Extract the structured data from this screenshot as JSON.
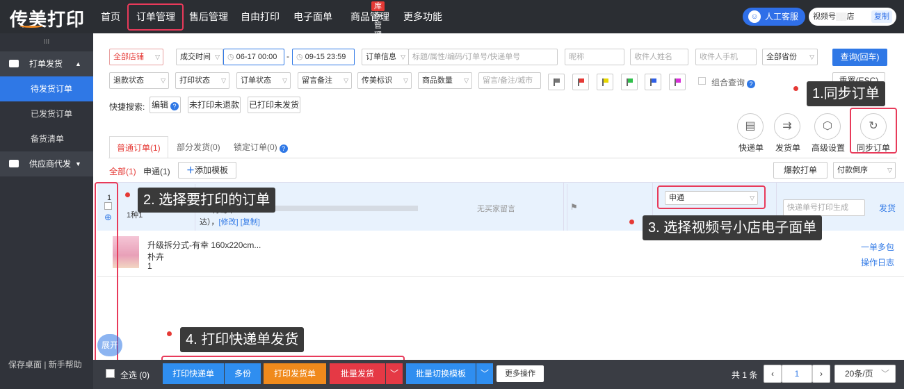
{
  "topbar": {
    "logo": "传美打印",
    "nav": [
      "首页",
      "订单管理",
      "售后管理",
      "自由打印",
      "电子面单",
      "商品管理",
      "更多功能"
    ],
    "inventory_badge": "库存管理",
    "service": "人工客服",
    "shop": "视频号",
    "shop_suffix": "店",
    "copy": "复制"
  },
  "sidebar": {
    "group1": "打单发货",
    "items": [
      "待发货订单",
      "已发货订单",
      "备货清单"
    ],
    "group2": "供应商代发",
    "footer": "保存桌面 | 新手帮助"
  },
  "filters": {
    "shop": "全部店铺",
    "time_type": "成交时间",
    "start": "06-17 00:00",
    "dash": "-",
    "end": "09-15 23:59",
    "order_info": "订单信息",
    "order_info_ph": "标题/属性/编码/订单号/快递单号",
    "nick_ph": "昵称",
    "receiver_ph": "收件人姓名",
    "phone_ph": "收件人手机",
    "province": "全部省份",
    "query": "查询(回车)",
    "refund": "退款状态",
    "print_status": "打印状态",
    "order_status": "订单状态",
    "remark": "留言备注",
    "mark": "传美标识",
    "qty": "商品数量",
    "remark_ph": "留言/备注/城市",
    "combo": "组合查询",
    "reset": "重置(ESC)"
  },
  "quick": {
    "label": "快捷搜索:",
    "edit": "编辑",
    "q1": "未打印未退款",
    "q2": "已打印未发货"
  },
  "flag_colors": [
    "#777777",
    "#e53935",
    "#e8d800",
    "#2fbf4a",
    "#2f5fe8",
    "#d82fd8"
  ],
  "tools": [
    "快递单",
    "发货单",
    "高级设置",
    "同步订单"
  ],
  "tabs": [
    "普通订单(1)",
    "部分发货(0)",
    "锁定订单(0)"
  ],
  "subtabs": {
    "all": "全部(1)",
    "carrier": "申通(1)",
    "add_tpl": "添加模板",
    "hot_print": "爆款打单",
    "sort": "付款倒序"
  },
  "order": {
    "index": "1",
    "count": "1种1",
    "address": "青岛市",
    "address_tail": "达）",
    "edit": "[修改]",
    "copy": "[复制]",
    "no_msg": "无买家留言",
    "carrier": "申通",
    "print_express": "打印快递单",
    "print_invoice": "打印发货单",
    "tracking_ph": "快递单号打印生成",
    "ship": "发货"
  },
  "goods": {
    "title": "升级拆分式-有幸 160x220cm...",
    "attr": "朴卉",
    "qty": "1",
    "multi": "一单多包",
    "log": "操作日志"
  },
  "callouts": [
    "1.同步订单",
    "2. 选择要打印的订单",
    "3. 选择视频号小店电子面单",
    "4. 打印快递单发货"
  ],
  "bottom": {
    "expand": "展开",
    "select_all": "全选 (0)",
    "print_express": "打印快递单",
    "multi": "多份",
    "print_invoice": "打印发货单",
    "batch_ship": "批量发货",
    "switch_tpl": "批量切换模板",
    "more": "更多操作",
    "total": "共 1 条",
    "page": "1",
    "per_page": "20条/页"
  }
}
